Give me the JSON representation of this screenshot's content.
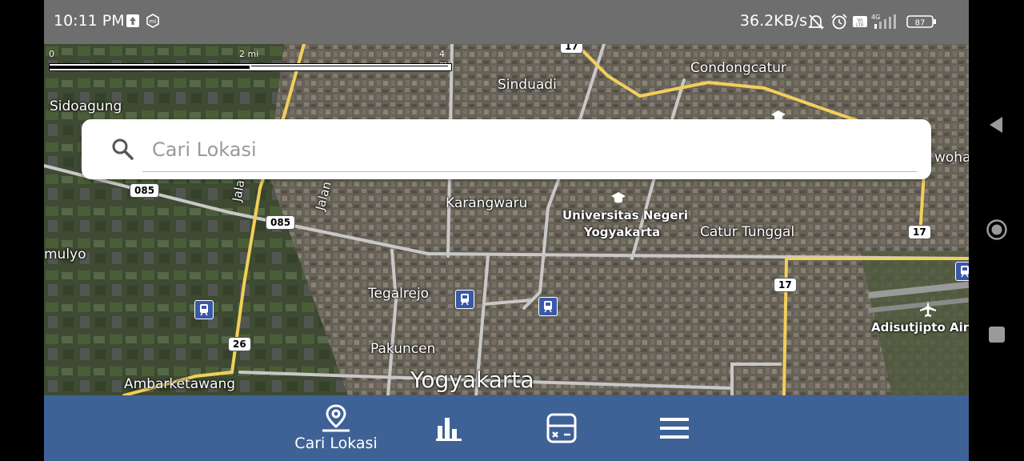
{
  "status_bar": {
    "time": "10:11 PM",
    "network_speed": "36.2KB/s",
    "battery": "87",
    "network_type": "4G",
    "icons": [
      "upload-icon",
      "mi-icon",
      "bell-off-icon",
      "alarm-icon",
      "volte-icon",
      "signal-icon",
      "battery-icon"
    ]
  },
  "map": {
    "scale": {
      "ticks": [
        "0",
        "2 mi",
        "4 mi"
      ]
    },
    "labels": {
      "sidoagung": "Sidoagung",
      "sinduadi": "Sinduadi",
      "condongcatur": "Condongcatur",
      "wohar": "wohar",
      "karangwaru": "Karangwaru",
      "uny": "Universitas Negeri\nYogyakarta",
      "uny_line1": "Universitas Negeri",
      "uny_line2": "Yogyakarta",
      "catur_tunggal": "Catur Tunggal",
      "mulyo": "mulyo",
      "tegalrejo": "Tegalrejo",
      "pakuncen": "Pakuncen",
      "ambarketawang": "Ambarketawang",
      "yogyakarta": "Yogyakarta",
      "adisutjipto": "Adisutjipto Airp",
      "jalan_siliwangi": "Jalan Siliw",
      "jalan_siliwangi_2": "Jalan Siliwa",
      "jalan": "Jalan"
    },
    "shields": {
      "s17_top": "17",
      "s085_a": "085",
      "s085_b": "085",
      "s17_right": "17",
      "s17_mid": "17",
      "s26": "26"
    }
  },
  "search": {
    "placeholder": "Cari Lokasi",
    "value": ""
  },
  "bottom_nav": {
    "items": [
      {
        "label": "Cari Lokasi",
        "icon": "location-pin-icon",
        "active": true
      },
      {
        "label": "",
        "icon": "bar-chart-icon",
        "active": false
      },
      {
        "label": "",
        "icon": "calculator-icon",
        "active": false
      },
      {
        "label": "",
        "icon": "menu-icon",
        "active": false
      }
    ]
  },
  "colors": {
    "status_bar": "#6e6e6e",
    "bottom_nav": "#3f6296",
    "road_major": "#f2cf5b",
    "road_minor": "#c8c8c8",
    "transit": "#3a58a8"
  }
}
